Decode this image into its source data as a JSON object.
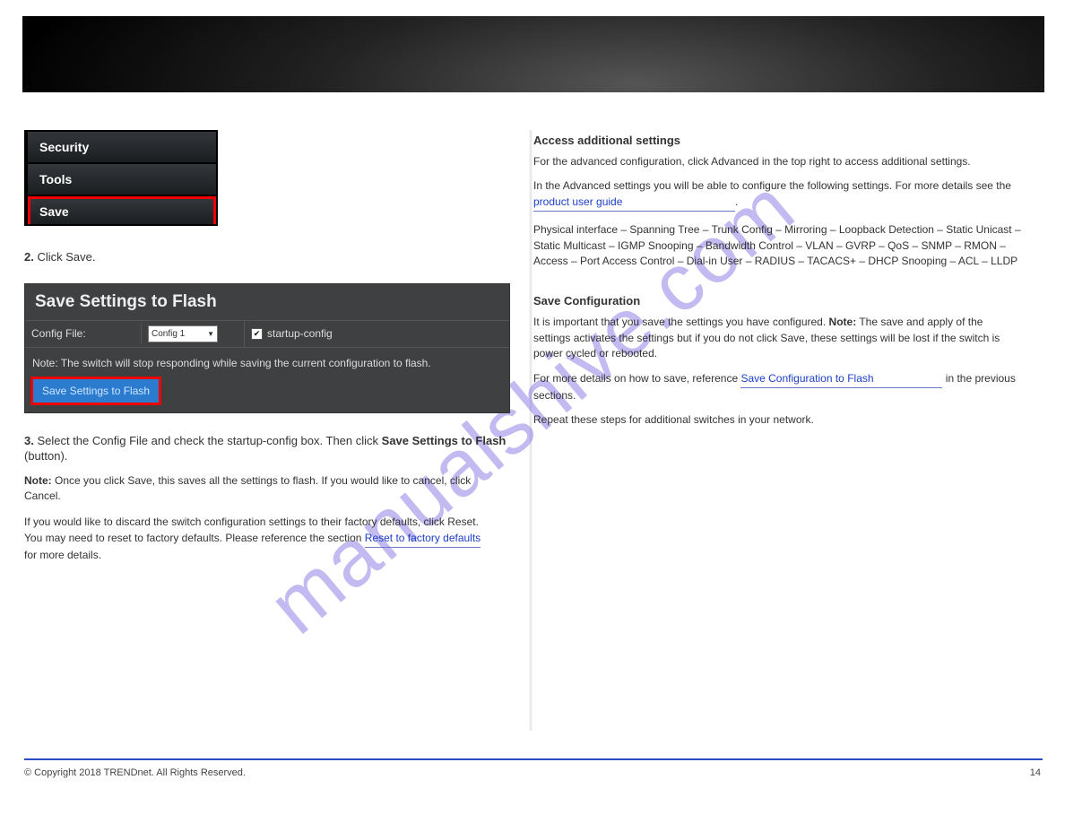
{
  "watermark": "manualshive.com",
  "left": {
    "nav": [
      "Security",
      "Tools",
      "Save"
    ],
    "step2_pre": "2.",
    "step2_text": " Click Save. ",
    "flash_title": "Save Settings to Flash",
    "cfg_label": "Config File:",
    "cfg_selected": "Config 1",
    "chk_label": "startup-config",
    "flash_note": "Note: The switch will stop responding while saving the current configuration to flash.",
    "save_btn": "Save Settings to Flash",
    "step3_pre": "3.",
    "step3_text": " Select the Config File and check the startup-config box. Then click ",
    "step3_bold": "Save Settings to Flash",
    "step3_after": " (button). ",
    "note_label": "Note:",
    "note_text": " Once you click Save, this saves all the settings to flash. If you would like to cancel, click Cancel. ",
    "para1_a": "If you would like to discard the switch configuration settings to their factory defaults, click Reset. You may need to reset to factory defaults. Please reference the section ",
    "para1_link": "Reset to factory defaults",
    "para1_b": " for more details."
  },
  "right": {
    "head1": "Access additional settings",
    "text1": "For the advanced configuration, click Advanced in the top right to access additional settings.",
    "text2": "In the Advanced settings you will be able to configure the following settings. For more details see the ",
    "link2": "product user guide",
    "text2b": ".",
    "bullets": "Physical interface – Spanning Tree – Trunk Config – Mirroring – Loopback Detection – Static Unicast – Static Multicast – IGMP Snooping – Bandwidth Control – VLAN – GVRP – QoS – SNMP – RMON – Access – Port Access Control – Dial-in User – RADIUS – TACACS+ – DHCP Snooping – ACL – LLDP",
    "head2": "Save Configuration",
    "text3a": "It is important that you save the settings you have configured. ",
    "note_label": "Note:",
    "text3b": " The save and apply of the settings activates the settings but if you do not click Save, these settings will be lost if the switch is power cycled or rebooted.",
    "text4a": "For more details on how to save, reference ",
    "link4": "Save Configuration to Flash",
    "text4b": " in the previous sections.",
    "text5": "Repeat these steps for additional switches in your network."
  },
  "footer": {
    "c": "© Copyright 2018 TRENDnet. All Rights Reserved.",
    "r": "14"
  }
}
